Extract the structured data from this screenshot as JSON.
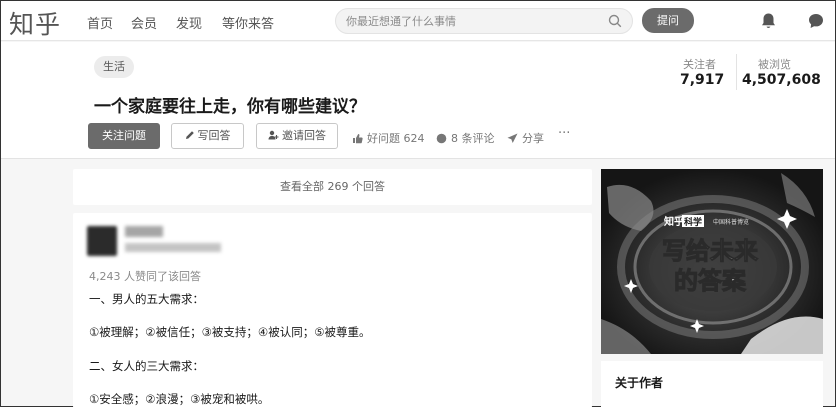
{
  "app": {
    "logo": "知乎"
  },
  "nav": {
    "items": [
      "首页",
      "会员",
      "发现",
      "等你来答"
    ]
  },
  "search": {
    "placeholder": "你最近想通了什么事情"
  },
  "header": {
    "ask_label": "提问",
    "icons": [
      "bell-icon",
      "message-icon"
    ]
  },
  "question": {
    "topic": "生活",
    "title": "一个家庭要往上走，你有哪些建议？",
    "buttons": {
      "follow": "关注问题",
      "answer": "写回答",
      "invite": "邀请回答"
    },
    "actions": {
      "good": "好问题 624",
      "comments": "8 条评论",
      "share": "分享",
      "more": "···"
    },
    "stats": {
      "followers_label": "关注者",
      "followers": "7,917",
      "views_label": "被浏览",
      "views": "4,507,608"
    }
  },
  "answers": {
    "view_all": "查看全部 269 个回答",
    "first": {
      "votes": "4,243 人赞同了该回答",
      "paragraphs": [
        "一、男人的五大需求：",
        "①被理解；②被信任；③被支持；④被认同；⑤被尊重。",
        "二、女人的三大需求：",
        "①安全感；②浪漫；③被宠和被哄。"
      ]
    }
  },
  "sidebar": {
    "banner": {
      "brand": "知乎",
      "brand_tag": "科学",
      "partner": "中国科普博览",
      "headline_1": "写给未来",
      "headline_2": "的答案"
    },
    "about_title": "关于作者"
  }
}
